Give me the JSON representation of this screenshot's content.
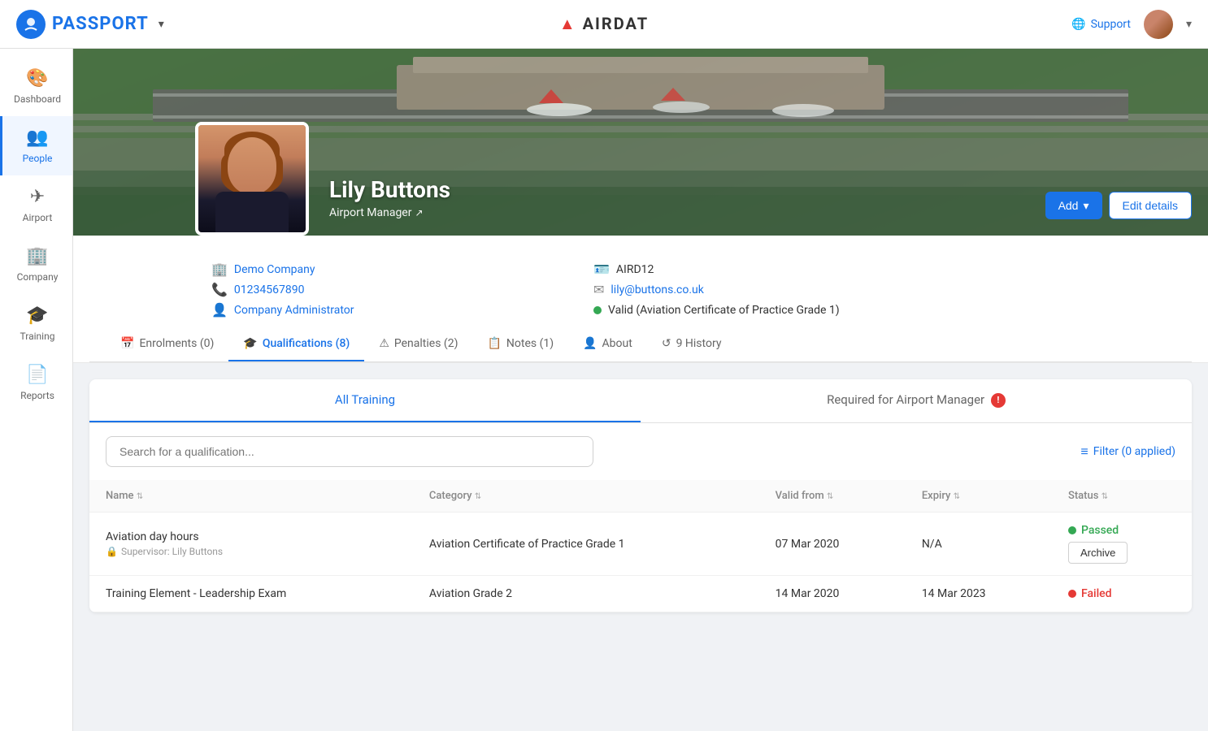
{
  "topnav": {
    "logo_text": "PASSPORT",
    "logo_icon": "P",
    "center_logo": "AIRDAT",
    "center_logo_prefix": "▲",
    "support_label": "Support",
    "dropdown_caret": "▾"
  },
  "sidebar": {
    "items": [
      {
        "id": "dashboard",
        "label": "Dashboard",
        "icon": "🎨"
      },
      {
        "id": "people",
        "label": "People",
        "icon": "👥"
      },
      {
        "id": "airport",
        "label": "Airport",
        "icon": "✈"
      },
      {
        "id": "company",
        "label": "Company",
        "icon": "🏢"
      },
      {
        "id": "training",
        "label": "Training",
        "icon": "🎓"
      },
      {
        "id": "reports",
        "label": "Reports",
        "icon": "📄"
      }
    ]
  },
  "profile": {
    "name": "Lily Buttons",
    "role": "Airport Manager",
    "company": "Demo Company",
    "phone": "01234567890",
    "job_title": "Company Administrator",
    "aird_code": "AIRD12",
    "email": "lily@buttons.co.uk",
    "valid_status": "Valid (Aviation Certificate of Practice Grade 1)",
    "add_button": "Add",
    "edit_button": "Edit details"
  },
  "tabs": [
    {
      "id": "enrolments",
      "label": "Enrolments (0)",
      "icon": "📅",
      "active": false
    },
    {
      "id": "qualifications",
      "label": "Qualifications (8)",
      "icon": "🎓",
      "active": true
    },
    {
      "id": "penalties",
      "label": "Penalties (2)",
      "icon": "⚠",
      "active": false
    },
    {
      "id": "notes",
      "label": "Notes (1)",
      "icon": "📋",
      "active": false
    },
    {
      "id": "about",
      "label": "About",
      "icon": "👤",
      "active": false
    },
    {
      "id": "history",
      "label": "History",
      "icon": "↺",
      "active": false,
      "badge": "9"
    }
  ],
  "qualifications": {
    "sub_tabs": [
      {
        "id": "all_training",
        "label": "All Training",
        "active": true
      },
      {
        "id": "required",
        "label": "Required for Airport Manager",
        "active": false,
        "warning": true
      }
    ],
    "search_placeholder": "Search for a qualification...",
    "filter_label": "Filter (0 applied)",
    "table_headers": [
      {
        "label": "Name",
        "sortable": true
      },
      {
        "label": "Category",
        "sortable": true
      },
      {
        "label": "Valid from",
        "sortable": true
      },
      {
        "label": "Expiry",
        "sortable": true
      },
      {
        "label": "Status",
        "sortable": true
      }
    ],
    "rows": [
      {
        "name": "Aviation day hours",
        "supervisor": "Supervisor: Lily Buttons",
        "category": "Aviation Certificate of Practice Grade 1",
        "valid_from": "07 Mar 2020",
        "expiry": "N/A",
        "status": "Passed",
        "status_type": "passed",
        "show_archive": true,
        "archive_label": "Archive"
      },
      {
        "name": "Training Element - Leadership Exam",
        "supervisor": "",
        "category": "Aviation Grade 2",
        "valid_from": "14 Mar 2020",
        "expiry": "14 Mar 2023",
        "status": "Failed",
        "status_type": "failed",
        "show_archive": false,
        "archive_label": ""
      }
    ]
  }
}
